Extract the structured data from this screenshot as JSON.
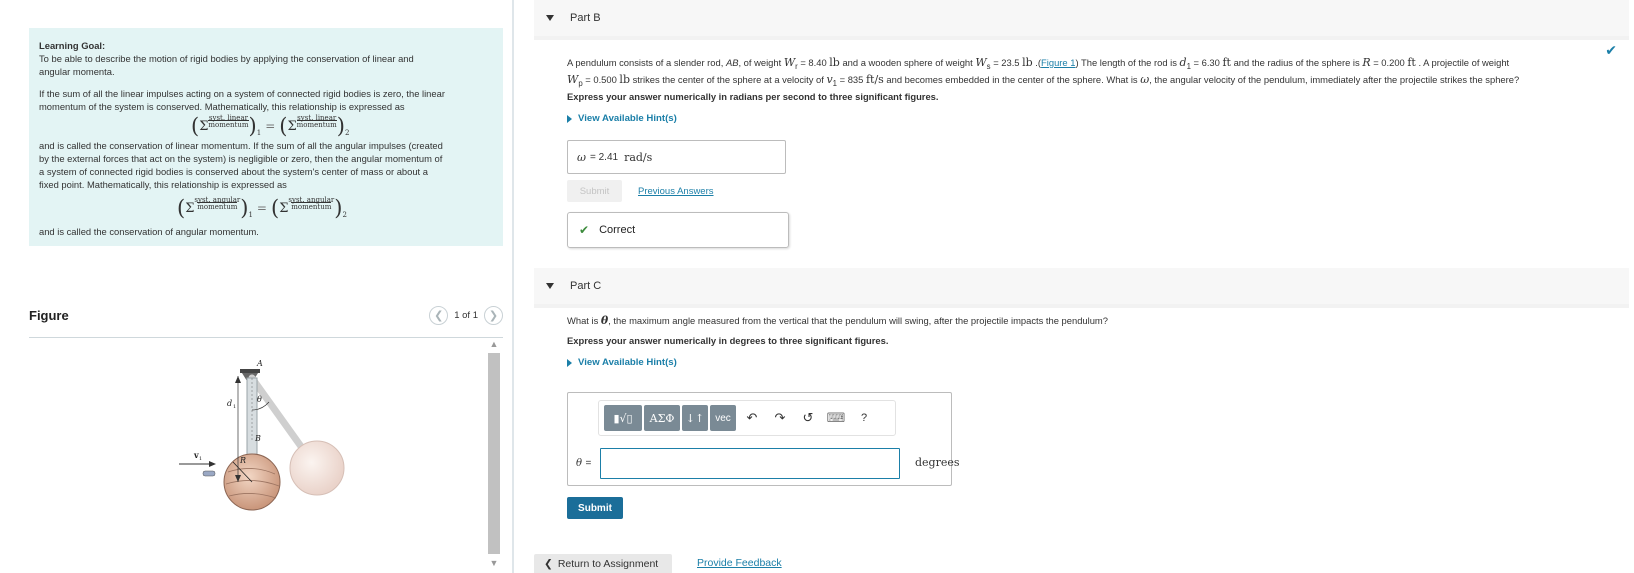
{
  "learning_goal": {
    "title": "Learning Goal:",
    "line1": "To be able to describe the motion of rigid bodies by applying the conservation of linear and",
    "line2": "angular momenta.",
    "para2_l1": "If the sum of all the linear impulses acting on a system of connected rigid bodies is zero, the linear",
    "para2_l2": "momentum of the system is conserved. Mathematically, this relationship is expressed as",
    "para3_l1": "and is called the conservation of linear momentum. If the sum of all the angular impulses (created",
    "para3_l2": "by the external forces that act on the system) is negligible or zero, then the angular momentum of",
    "para3_l3": "a system of connected rigid bodies is conserved about the system's center of mass or about a",
    "para3_l4": "fixed point. Mathematically, this relationship is expressed as",
    "para4": "and is called the conservation of angular momentum.",
    "eq1": {
      "top": "syst. linear",
      "bottom": "momentum",
      "sub1": "1",
      "sub2": "2"
    },
    "eq2": {
      "top": "syst. angular",
      "bottom": "momentum",
      "sub1": "1",
      "sub2": "2"
    }
  },
  "figure": {
    "title": "Figure",
    "pager": "1 of 1",
    "labels": {
      "A": "A",
      "B": "B",
      "theta": "θ",
      "d1": "d",
      "d1_sub": "1",
      "R": "R",
      "v1": "v",
      "v1_sub": "1"
    }
  },
  "part_b": {
    "header": "Part B",
    "problem": {
      "t1": "A pendulum consists of a slender rod, ",
      "ab": "AB",
      "t2": ", of weight ",
      "wr": "W",
      "wr_sub": "r",
      "wr_val": " = 8.40 ",
      "lb1": "lb",
      "t3": " and a wooden sphere of weight ",
      "ws": "W",
      "ws_sub": "s",
      "ws_val": " = 23.5 ",
      "lb2": "lb",
      "t4": " .(",
      "fig_link": "Figure 1",
      "t5": ") The length of the rod is ",
      "d1": "d",
      "d1_sub": "1",
      "d1_val": " = 6.30 ",
      "ft1": "ft",
      "t6": " and the radius of the sphere is ",
      "r": "R",
      "r_val": " = 0.200 ",
      "ft2": "ft",
      "t7": " . A projectile of weight",
      "wp": "W",
      "wp_sub": "p",
      "wp_val": " = 0.500 ",
      "lb3": "lb",
      "t8": " strikes the center of the sphere at a velocity of ",
      "v1": "v",
      "v1_sub": "1",
      "v1_val": " = 835 ",
      "fts": "ft/s",
      "t9": " and becomes embedded in the center of the sphere. What is ",
      "omega": "ω",
      "t10": ", the angular velocity of the pendulum, immediately after the projectile strikes the sphere?"
    },
    "instruction": "Express your answer numerically in radians per second to three significant figures.",
    "hint": "View Available Hint(s)",
    "answer_var": "ω",
    "answer_eq": "=",
    "answer_value": "2.41",
    "answer_unit": "rad/s",
    "submit": "Submit",
    "previous_answers": "Previous Answers",
    "correct": "Correct"
  },
  "part_c": {
    "header": "Part C",
    "q1": "What is ",
    "theta": "θ",
    "q2": ", the maximum angle measured from the vertical that the pendulum will swing, after the projectile impacts the pendulum?",
    "instruction": "Express your answer numerically in degrees to three significant figures.",
    "hint": "View Available Hint(s)",
    "toolbar": {
      "templates": "▮√▯",
      "greek": "ΑΣΦ",
      "arrows": "↓↑",
      "vec": "vec",
      "undo": "↶",
      "redo": "↷",
      "reset": "↺",
      "keyboard": "⌨",
      "help": "?"
    },
    "input_var": "θ",
    "input_eq": "=",
    "input_value": "",
    "unit": "degrees",
    "submit": "Submit"
  },
  "footer": {
    "return": "Return to Assignment",
    "feedback": "Provide Feedback"
  },
  "colors": {
    "goal_bg": "#e3f4f4",
    "link": "#1b7fa8",
    "submit": "#1b6e99",
    "correct": "#3c8b3c"
  }
}
